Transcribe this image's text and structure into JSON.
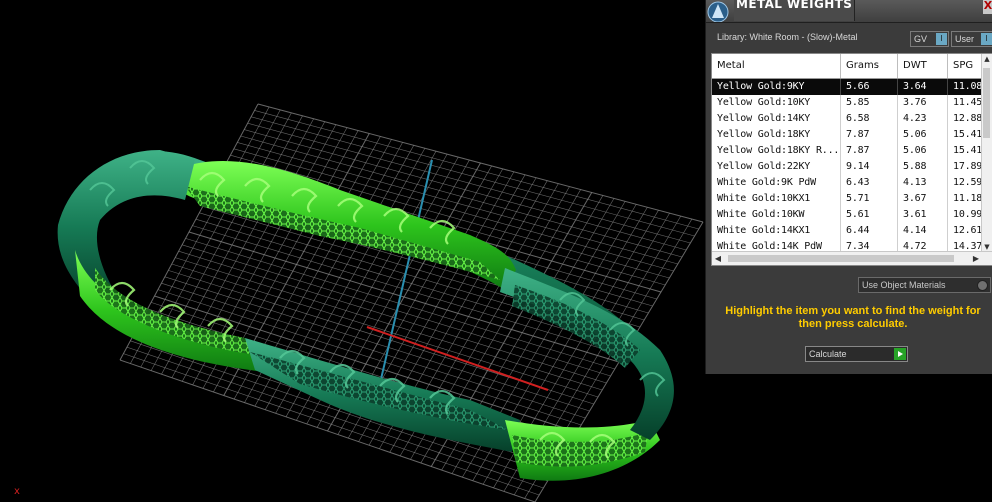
{
  "window": {
    "title": "METAL WEIGHTS",
    "close_glyph": "X"
  },
  "library": {
    "label": "Library: White Room - (Slow)-Metal"
  },
  "toggles": {
    "gv_label": "GV",
    "user_label": "User",
    "indicator": "I"
  },
  "table": {
    "headers": [
      "Metal",
      "Grams",
      "DWT",
      "SPG"
    ],
    "rows": [
      [
        "Yellow Gold:9KY",
        "5.66",
        "3.64",
        "11.08"
      ],
      [
        "Yellow Gold:10KY",
        "5.85",
        "3.76",
        "11.45"
      ],
      [
        "Yellow Gold:14KY",
        "6.58",
        "4.23",
        "12.88"
      ],
      [
        "Yellow Gold:18KY",
        "7.87",
        "5.06",
        "15.41"
      ],
      [
        "Yellow Gold:18KY R...",
        "7.87",
        "5.06",
        "15.41"
      ],
      [
        "Yellow Gold:22KY",
        "9.14",
        "5.88",
        "17.89"
      ],
      [
        "White Gold:9K PdW",
        "6.43",
        "4.13",
        "12.59"
      ],
      [
        "White Gold:10KX1",
        "5.71",
        "3.67",
        "11.18"
      ],
      [
        "White Gold:10KW",
        "5.61",
        "3.61",
        "10.99"
      ],
      [
        "White Gold:14KX1",
        "6.44",
        "4.14",
        "12.61"
      ],
      [
        "White Gold:14K PdW",
        "7.34",
        "4.72",
        "14.37"
      ]
    ]
  },
  "scroll": {
    "up": "▲",
    "down": "▼",
    "left": "◀",
    "right": "▶"
  },
  "use_object_materials": {
    "label": "Use Object Materials"
  },
  "hint": "Highlight the item you want to find the weight for then press calculate.",
  "calculate": {
    "label": "Calculate"
  },
  "viewport": {
    "axis_labels": {
      "x": "x"
    }
  },
  "colors": {
    "selection_row": "#0a0a0a",
    "hint_text": "#ffcc00",
    "ring_bright": "#33cc22",
    "ring_dark": "#157a4e",
    "grid": "#8a8a8a",
    "axis_x": "#d02020",
    "axis_z": "#2a8fb0"
  }
}
